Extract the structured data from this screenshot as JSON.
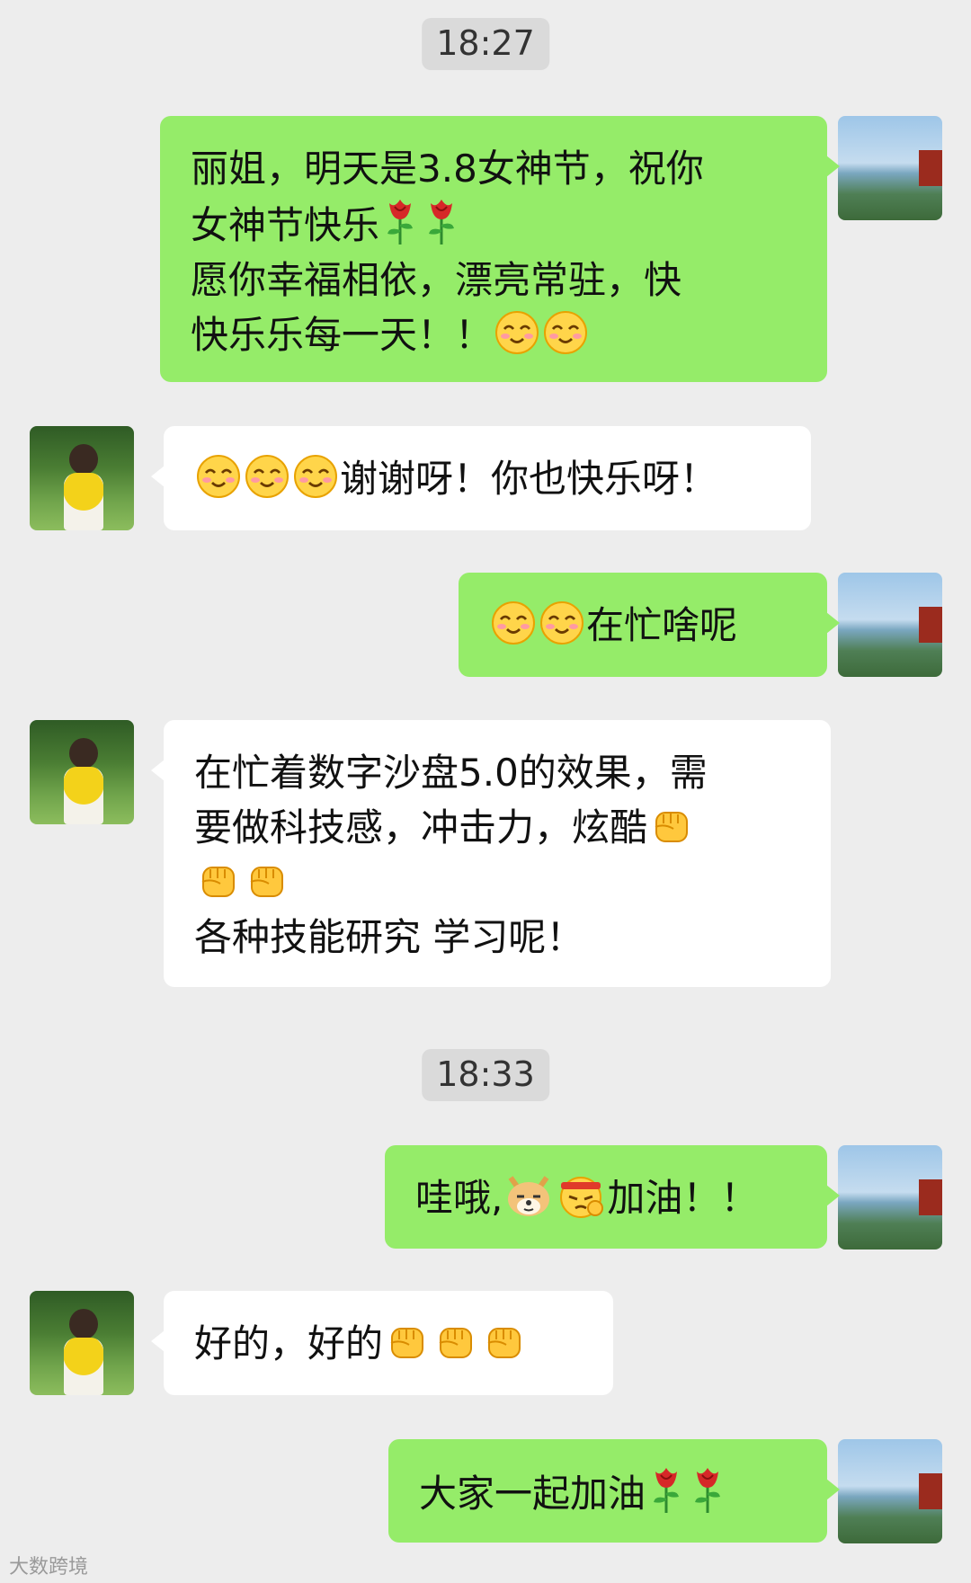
{
  "timestamps": [
    "18:27",
    "18:33"
  ],
  "messages": [
    {
      "lines": [
        [
          {
            "t": "丽姐，明天是3.8女神节，祝你"
          }
        ],
        [
          {
            "t": "女神节快乐"
          },
          {
            "e": "rose-icon"
          },
          {
            "e": "rose-icon"
          }
        ],
        [
          {
            "t": "愿你幸福相依，漂亮常驻，快"
          }
        ],
        [
          {
            "t": "快乐乐每一天！！"
          },
          {
            "e": "smile-icon"
          },
          {
            "e": "smile-icon"
          }
        ]
      ]
    },
    {
      "lines": [
        [
          {
            "e": "smile-icon"
          },
          {
            "e": "smile-icon"
          },
          {
            "e": "smile-icon"
          },
          {
            "t": "谢谢呀！你也快乐呀！"
          }
        ]
      ]
    },
    {
      "lines": [
        [
          {
            "e": "smile-icon"
          },
          {
            "e": "smile-icon"
          },
          {
            "t": "在忙啥呢"
          }
        ]
      ]
    },
    {
      "lines": [
        [
          {
            "t": "在忙着数字沙盘5.0的效果，需"
          }
        ],
        [
          {
            "t": "要做科技感，冲击力，炫酷"
          },
          {
            "e": "fist-icon"
          }
        ],
        [
          {
            "e": "fist-icon"
          },
          {
            "e": "fist-icon"
          }
        ],
        [
          {
            "t": "各种技能研究 学习呢！"
          }
        ]
      ]
    },
    {
      "lines": [
        [
          {
            "t": "哇哦,"
          },
          {
            "e": "doge-icon"
          },
          {
            "e": "determined-icon"
          },
          {
            "t": "加油！！"
          }
        ]
      ]
    },
    {
      "lines": [
        [
          {
            "t": "好的，好的"
          },
          {
            "e": "fist-icon"
          },
          {
            "e": "fist-icon"
          },
          {
            "e": "fist-icon"
          }
        ]
      ]
    },
    {
      "lines": [
        [
          {
            "t": "大家一起加油"
          },
          {
            "e": "rose-icon"
          },
          {
            "e": "rose-icon"
          }
        ]
      ]
    }
  ],
  "watermark": "大数跨境"
}
